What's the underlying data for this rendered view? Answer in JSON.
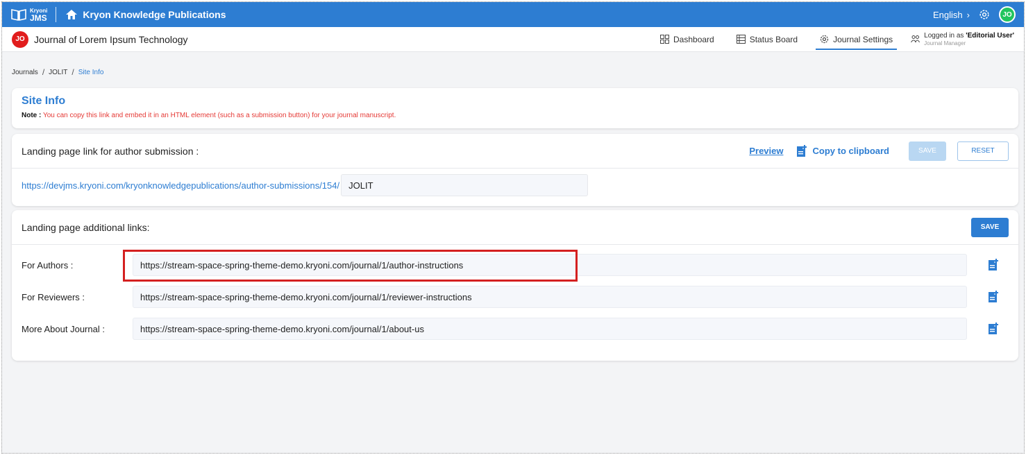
{
  "brand": {
    "logo_small": "Kryoni",
    "logo_big": "JMS",
    "publication": "Kryon Knowledge Publications",
    "language": "English",
    "user_initials": "JO"
  },
  "journal": {
    "initials": "JO",
    "title": "Journal of Lorem Ipsum Technology"
  },
  "nav": {
    "dashboard": "Dashboard",
    "status_board": "Status Board",
    "journal_settings": "Journal Settings",
    "logged_in_prefix": "Logged in as ",
    "logged_in_user": "'Editorial User'",
    "role": "Journal Manager"
  },
  "breadcrumb": {
    "items": [
      "Journals",
      "JOLIT",
      "Site Info"
    ],
    "separator": "/"
  },
  "site_info": {
    "title": "Site Info",
    "note_label": "Note :",
    "note_text": "You can copy this link and embed it in an HTML element (such as a submission button) for your journal manuscript."
  },
  "landing": {
    "title": "Landing page link for author submission :",
    "preview": "Preview",
    "copy": "Copy to clipboard",
    "save": "SAVE",
    "reset": "RESET",
    "url_prefix": "https://devjms.kryoni.com/kryonknowledgepublications/author-submissions/154/",
    "input_value": "JOLIT"
  },
  "additional": {
    "title": "Landing page additional links:",
    "save": "SAVE",
    "rows": [
      {
        "label": "For Authors :",
        "value": "https://stream-space-spring-theme-demo.kryoni.com/journal/1/author-instructions"
      },
      {
        "label": "For Reviewers :",
        "value": "https://stream-space-spring-theme-demo.kryoni.com/journal/1/reviewer-instructions"
      },
      {
        "label": "More About Journal :",
        "value": "https://stream-space-spring-theme-demo.kryoni.com/journal/1/about-us"
      }
    ]
  },
  "colors": {
    "primary": "#2d7dd2",
    "note_red": "#e53935",
    "highlight_red": "#d42020",
    "user_green": "#22c55e",
    "journal_red": "#e11d1d"
  }
}
